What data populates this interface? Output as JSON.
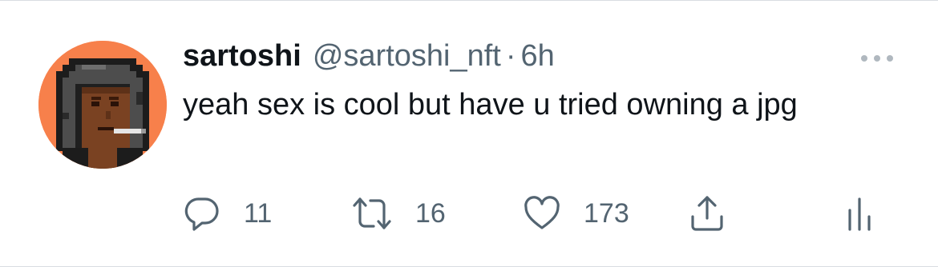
{
  "tweet": {
    "author": {
      "display_name": "sartoshi",
      "handle": "@sartoshi_nft",
      "separator": "·",
      "time": "6h",
      "avatar_icon": "pixel-avatar-hooded-figure-icon"
    },
    "text": "yeah sex is cool but have u tried owning a jpg",
    "actions": {
      "reply": {
        "icon": "reply-icon",
        "count": "11"
      },
      "retweet": {
        "icon": "retweet-icon",
        "count": "16"
      },
      "like": {
        "icon": "heart-icon",
        "count": "173"
      },
      "share": {
        "icon": "share-icon"
      },
      "analytics": {
        "icon": "analytics-icon"
      }
    },
    "more_icon": "more-options-icon"
  },
  "colors": {
    "text_primary": "#0f1419",
    "text_secondary": "#536471",
    "icon": "#536471",
    "divider": "#d9dde1",
    "avatar_background": "#f7804b"
  }
}
